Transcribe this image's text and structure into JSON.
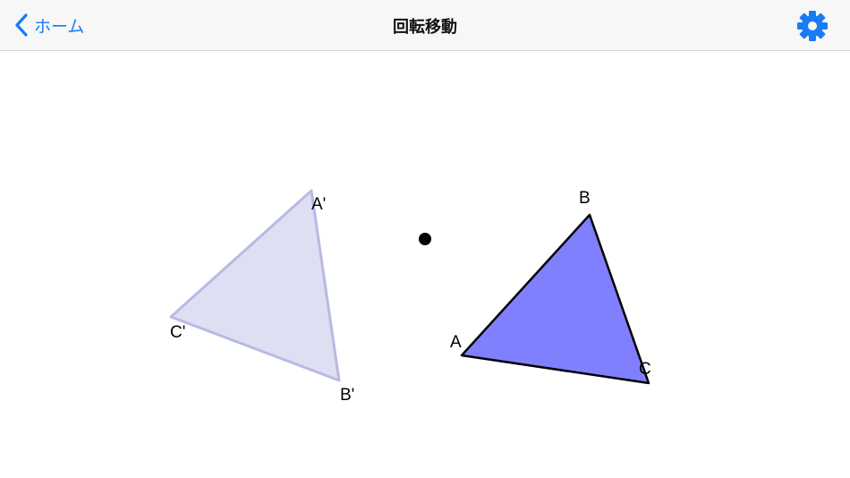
{
  "navbar": {
    "back_label": "ホーム",
    "title": "回転移動",
    "back_icon": "chevron-left-icon",
    "settings_icon": "gear-icon"
  },
  "colors": {
    "accent": "#1a7cf5",
    "original_fill": "#8080ff",
    "image_fill": "#dedff2",
    "image_stroke": "#b8b9e4"
  },
  "figure": {
    "original_triangle": {
      "labels": {
        "a": "A",
        "b": "B",
        "c": "C"
      }
    },
    "rotated_triangle": {
      "labels": {
        "a": "A'",
        "b": "B'",
        "c": "C'"
      }
    }
  }
}
